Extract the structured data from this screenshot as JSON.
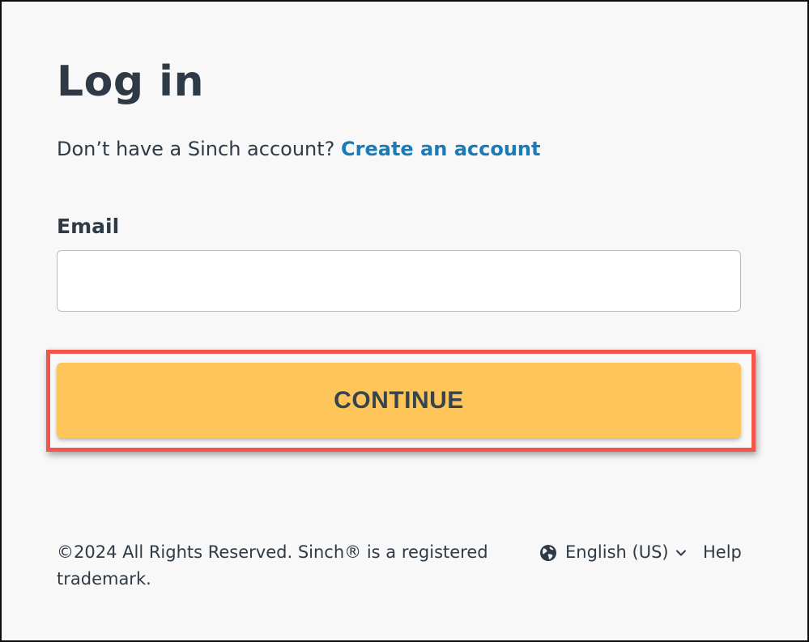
{
  "page": {
    "title": "Log in"
  },
  "signup": {
    "prompt": "Don’t have a Sinch account? ",
    "link_label": "Create an account"
  },
  "form": {
    "email_label": "Email",
    "email_value": "",
    "email_placeholder": "",
    "continue_label": "CONTINUE"
  },
  "footer": {
    "copyright": "©2024 All Rights Reserved. Sinch® is a registered trademark.",
    "language": "English (US)",
    "help": "Help"
  },
  "icons": {
    "language": "globe-icon",
    "language_dropdown": "chevron-down-icon"
  },
  "colors": {
    "text": "#2e3a45",
    "link": "#1a7bb8",
    "button": "#fdc55a",
    "highlight": "#f2564a",
    "background": "#f8f8f8"
  }
}
